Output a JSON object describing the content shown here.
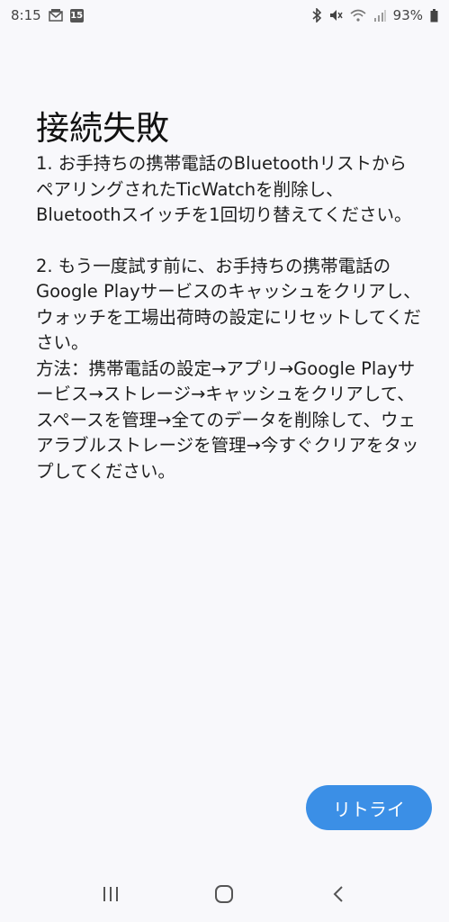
{
  "status_bar": {
    "time": "8:15",
    "calendar_day": "15",
    "battery": "93%",
    "icons": [
      "mail-icon",
      "calendar-icon",
      "bluetooth-icon",
      "mute-icon",
      "wifi-icon",
      "signal-icon",
      "battery-icon"
    ]
  },
  "page": {
    "title": "接続失敗",
    "paragraph1": "1. お手持ちの携帯電話のBluetoothリストからペアリングされたTicWatchを削除し、Bluetoothスイッチを1回切り替えてください。",
    "paragraph2": "2. もう一度試す前に、お手持ちの携帯電話のGoogle Playサービスのキャッシュをクリアし、ウォッチを工場出荷時の設定にリセットしてください。",
    "paragraph3": "方法：携帯電話の設定→アプリ→Google Playサービス→ストレージ→キャッシュをクリアして、スペースを管理→全てのデータを削除して、ウェアラブルストレージを管理→今すぐクリアをタップしてください。"
  },
  "actions": {
    "retry_label": "リトライ"
  },
  "nav": {
    "icons": [
      "recent-apps-icon",
      "home-icon",
      "back-icon"
    ]
  },
  "colors": {
    "accent": "#3b8fe6",
    "background": "#f8f8fb"
  }
}
